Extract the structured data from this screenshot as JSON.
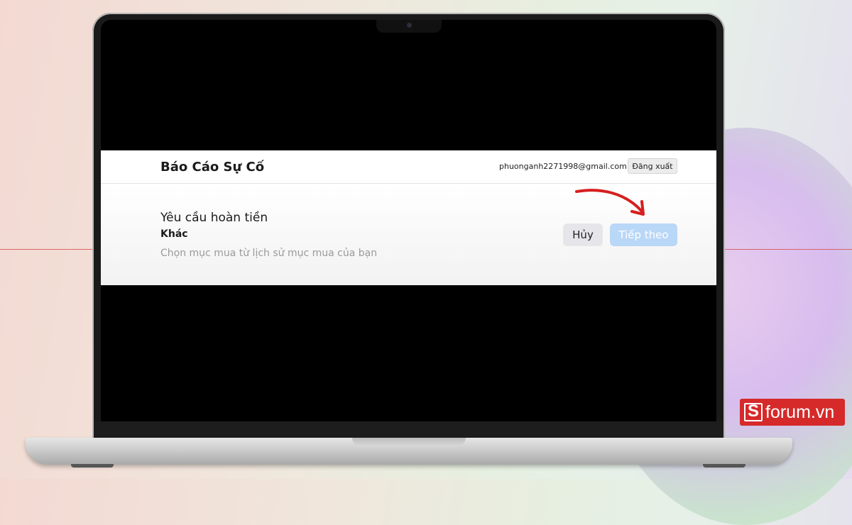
{
  "app": {
    "title": "Báo Cáo Sự Cố",
    "user_email": "phuonganh2271998@gmail.com",
    "logout_label": "Đăng xuất"
  },
  "request": {
    "title": "Yêu cầu hoàn tiền",
    "type": "Khác",
    "description": "Chọn mục mua từ lịch sử mục mua của bạn"
  },
  "actions": {
    "cancel_label": "Hủy",
    "next_label": "Tiếp theo"
  },
  "watermark": {
    "logo_letter": "S",
    "text": "forum.vn"
  },
  "colors": {
    "next_button": "#b9d7f7",
    "annotation_arrow": "#d61f1f",
    "logo_bg": "#d62a2a"
  }
}
